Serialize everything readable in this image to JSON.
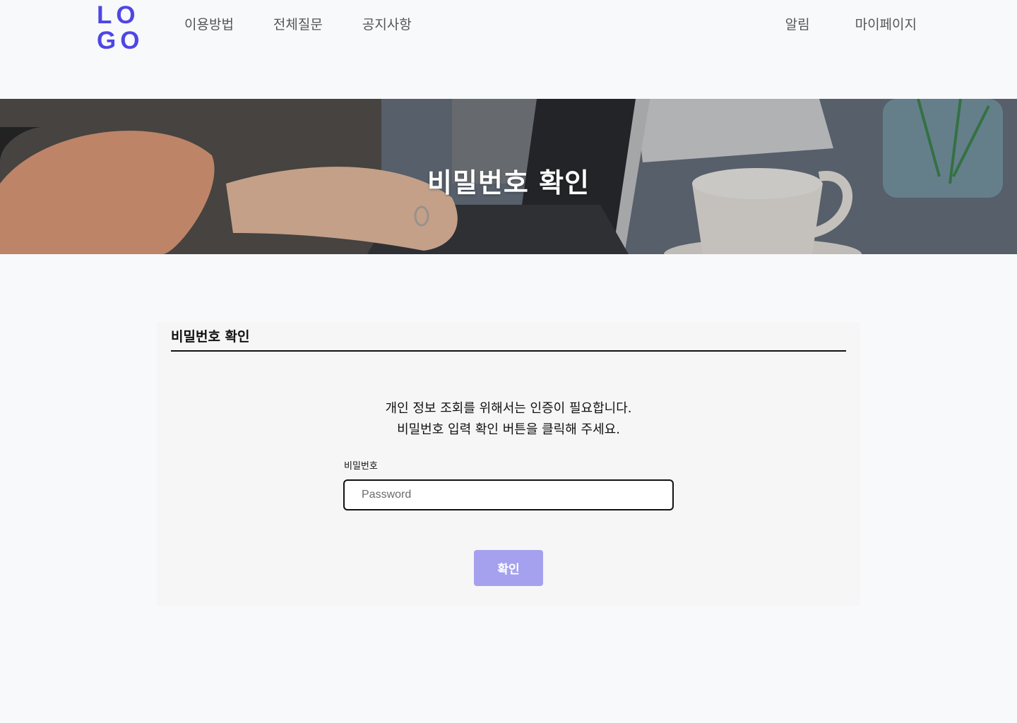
{
  "logo": {
    "line1": "LO",
    "line2": "GO"
  },
  "nav": {
    "left": [
      "이용방법",
      "전체질문",
      "공지사항"
    ],
    "right": [
      "알림",
      "마이페이지"
    ]
  },
  "hero": {
    "title": "비밀번호 확인"
  },
  "card": {
    "title": "비밀번호 확인",
    "description_line1": "개인 정보 조회를 위해서는 인증이 필요합니다.",
    "description_line2": "비밀번호 입력  확인 버튼을 클릭해 주세요.",
    "password_label": "비밀번호",
    "password_placeholder": "Password",
    "password_value": "",
    "confirm_label": "확인"
  },
  "colors": {
    "brand": "#4f46e5",
    "button": "#a5a1ee",
    "background": "#f8f9fb",
    "card": "#f6f6f6"
  }
}
